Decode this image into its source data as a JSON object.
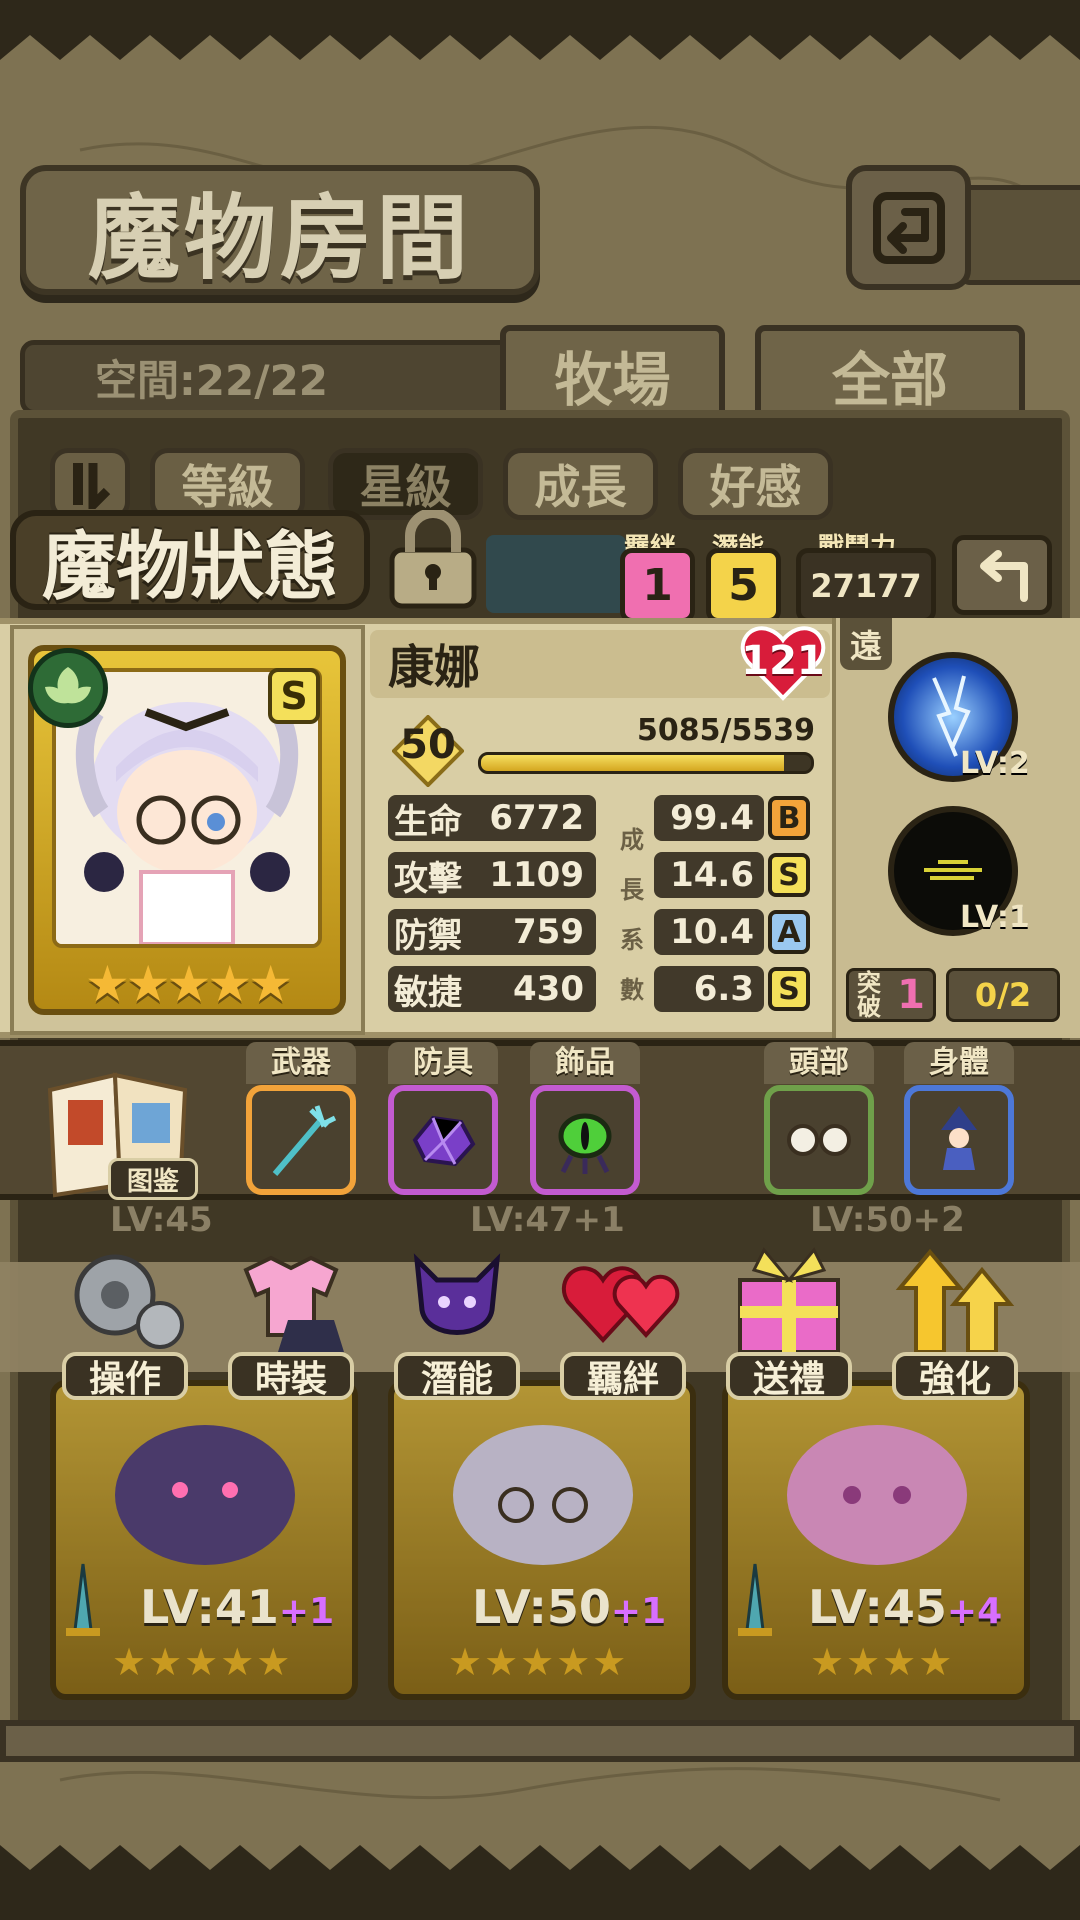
{
  "header": {
    "title": "魔物房間",
    "space_label": "空間:22/22",
    "tabs": [
      {
        "label": "牧場"
      },
      {
        "label": "全部"
      }
    ]
  },
  "filters": [
    {
      "label": "等級"
    },
    {
      "label": "星級"
    },
    {
      "label": "成長"
    },
    {
      "label": "好感"
    }
  ],
  "status": {
    "title": "魔物狀態",
    "bond_label": "羈絆",
    "bond_value": "1",
    "potential_label": "潛能",
    "potential_value": "5",
    "power_label": "戰鬥力",
    "power_value": "27177"
  },
  "monster": {
    "name": "康娜",
    "affinity": "121",
    "rank": "S",
    "level": "50",
    "exp_text": "5085/5539",
    "exp_fraction": 0.918,
    "stars": "★★★★★",
    "stats": [
      {
        "label": "生命",
        "value": "6772",
        "growth": "99.4",
        "grade": "B"
      },
      {
        "label": "攻擊",
        "value": "1109",
        "growth": "14.6",
        "grade": "S"
      },
      {
        "label": "防禦",
        "value": "759",
        "growth": "10.4",
        "grade": "A"
      },
      {
        "label": "敏捷",
        "value": "430",
        "growth": "6.3",
        "grade": "S"
      }
    ],
    "growth_label": [
      "成",
      "長",
      "系",
      "數"
    ]
  },
  "side": {
    "range": "遠",
    "skills": [
      {
        "level": "LV:2"
      },
      {
        "level": "LV:1"
      }
    ],
    "break_label_1": "突",
    "break_label_2": "破",
    "break_value": "1",
    "break_progress": "0/2"
  },
  "equipment": {
    "book_label": "图鉴",
    "slots": [
      {
        "label": "武器",
        "icon": "trident-icon"
      },
      {
        "label": "防具",
        "icon": "crystal-armor-icon"
      },
      {
        "label": "飾品",
        "icon": "eye-charm-icon"
      },
      {
        "label": "頭部",
        "icon": "glasses-icon"
      },
      {
        "label": "身體",
        "icon": "witch-costume-icon"
      }
    ]
  },
  "actions": [
    {
      "label": "操作",
      "icon": "gear-icon"
    },
    {
      "label": "時裝",
      "icon": "outfit-icon"
    },
    {
      "label": "潛能",
      "icon": "demon-icon"
    },
    {
      "label": "羈絆",
      "icon": "hearts-icon"
    },
    {
      "label": "送禮",
      "icon": "gift-icon"
    },
    {
      "label": "強化",
      "icon": "upgrade-arrows-icon"
    }
  ],
  "cards": [
    {
      "lv": "LV:41",
      "plus": "+1",
      "stars": "★★★★★"
    },
    {
      "lv": "LV:50",
      "plus": "+1",
      "stars": "★★★★★"
    },
    {
      "lv": "LV:45",
      "plus": "+4",
      "stars": "★★★★"
    }
  ],
  "overlap_levels": [
    "LV:45",
    "LV:47+1",
    "LV:50+2"
  ],
  "colors": {
    "accent_gold": "#e8c53a",
    "power_yellow": "#f4d34a",
    "heart_red": "#d81c3a",
    "bond_pink": "#f06fb0"
  }
}
